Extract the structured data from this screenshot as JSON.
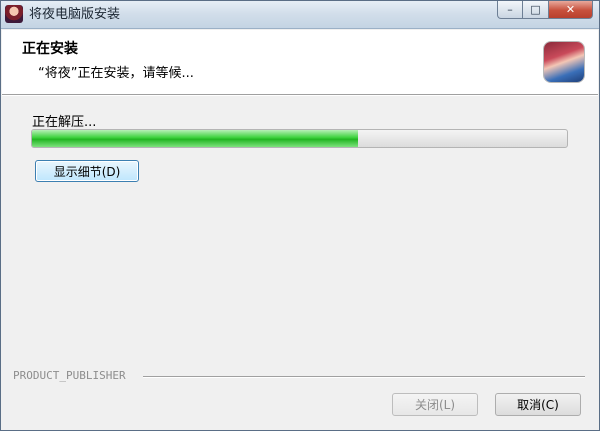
{
  "window": {
    "title": "将夜电脑版安装",
    "caption": {
      "minimize": "–",
      "maximize": "□",
      "close": "✕"
    }
  },
  "header": {
    "title": "正在安装",
    "subtitle": "“将夜”正在安装，请等候..."
  },
  "body": {
    "status": "正在解压...",
    "progress_fraction": 0.61,
    "details_button": "显示细节(D)"
  },
  "footer": {
    "publisher": "PRODUCT_PUBLISHER",
    "close_button": "关闭(L)",
    "cancel_button": "取消(C)"
  },
  "icons": {
    "app": "game-character-icon",
    "header_logo": "game-character-logo-icon"
  },
  "colors": {
    "progress_fill": "#2bc52b",
    "accent_border": "#3c7fb1"
  }
}
